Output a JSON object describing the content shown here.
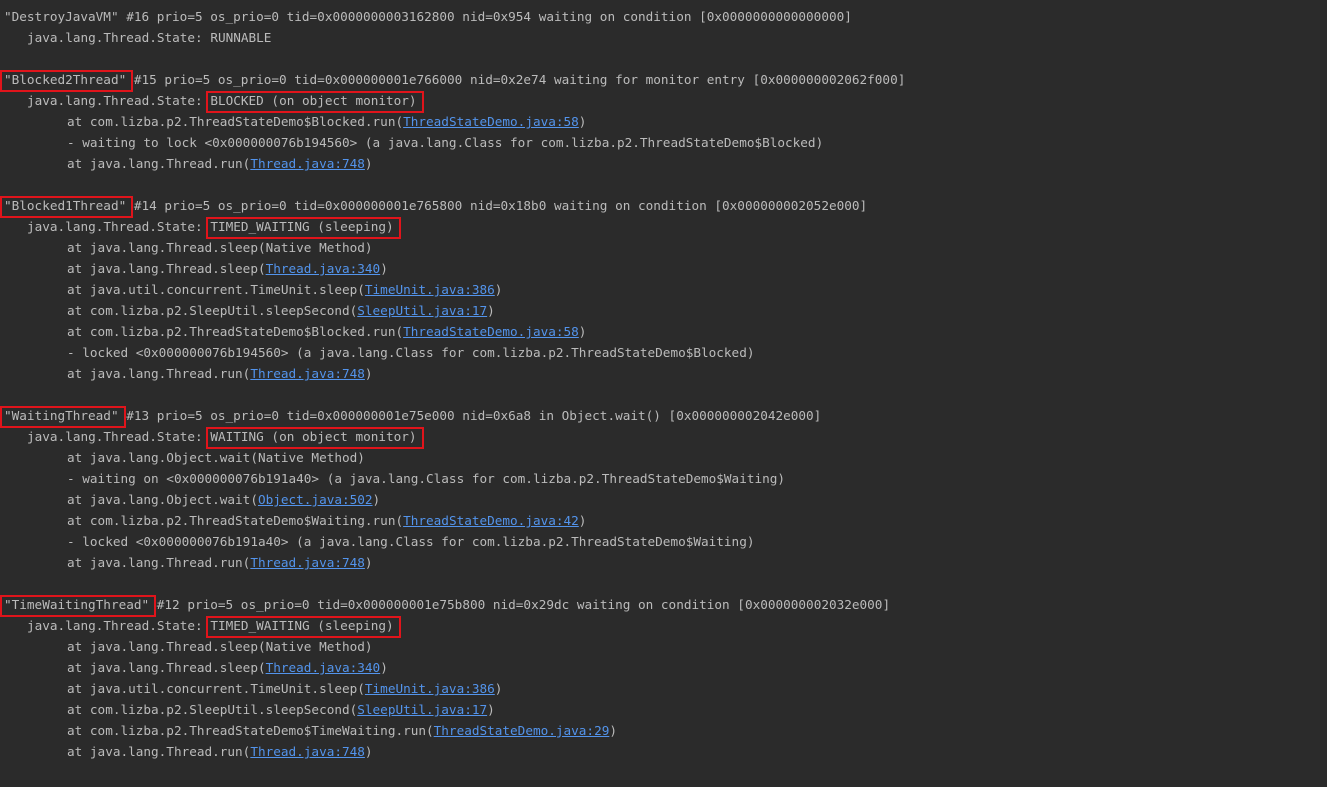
{
  "threads": [
    {
      "name": "\"DestroyJavaVM\"",
      "highlighted": false,
      "header_rest": " #16 prio=5 os_prio=0 tid=0x0000000003162800 nid=0x954 waiting on condition [0x0000000000000000]",
      "state_prefix": "java.lang.Thread.State: ",
      "state": "RUNNABLE",
      "state_highlighted": false,
      "frames": []
    },
    {
      "name": "\"Blocked2Thread\"",
      "highlighted": true,
      "header_rest": " #15 prio=5 os_prio=0 tid=0x000000001e766000 nid=0x2e74 waiting for monitor entry [0x000000002062f000]",
      "state_prefix": "java.lang.Thread.State: ",
      "state": "BLOCKED (on object monitor)",
      "state_highlighted": true,
      "frames": [
        {
          "pre": "at com.lizba.p2.ThreadStateDemo$Blocked.run(",
          "link": "ThreadStateDemo.java:58",
          "post": ")"
        },
        {
          "pre": "- waiting to lock <0x000000076b194560> (a java.lang.Class for com.lizba.p2.ThreadStateDemo$Blocked)",
          "link": "",
          "post": ""
        },
        {
          "pre": "at java.lang.Thread.run(",
          "link": "Thread.java:748",
          "post": ")"
        }
      ]
    },
    {
      "name": "\"Blocked1Thread\"",
      "highlighted": true,
      "header_rest": " #14 prio=5 os_prio=0 tid=0x000000001e765800 nid=0x18b0 waiting on condition [0x000000002052e000]",
      "state_prefix": "java.lang.Thread.State: ",
      "state": "TIMED_WAITING (sleeping)",
      "state_highlighted": true,
      "frames": [
        {
          "pre": "at java.lang.Thread.sleep(Native Method)",
          "link": "",
          "post": ""
        },
        {
          "pre": "at java.lang.Thread.sleep(",
          "link": "Thread.java:340",
          "post": ")"
        },
        {
          "pre": "at java.util.concurrent.TimeUnit.sleep(",
          "link": "TimeUnit.java:386",
          "post": ")"
        },
        {
          "pre": "at com.lizba.p2.SleepUtil.sleepSecond(",
          "link": "SleepUtil.java:17",
          "post": ")"
        },
        {
          "pre": "at com.lizba.p2.ThreadStateDemo$Blocked.run(",
          "link": "ThreadStateDemo.java:58",
          "post": ")"
        },
        {
          "pre": "- locked <0x000000076b194560> (a java.lang.Class for com.lizba.p2.ThreadStateDemo$Blocked)",
          "link": "",
          "post": ""
        },
        {
          "pre": "at java.lang.Thread.run(",
          "link": "Thread.java:748",
          "post": ")"
        }
      ]
    },
    {
      "name": "\"WaitingThread\"",
      "highlighted": true,
      "header_rest": " #13 prio=5 os_prio=0 tid=0x000000001e75e000 nid=0x6a8 in Object.wait() [0x000000002042e000]",
      "state_prefix": "java.lang.Thread.State: ",
      "state": "WAITING (on object monitor)",
      "state_highlighted": true,
      "frames": [
        {
          "pre": "at java.lang.Object.wait(Native Method)",
          "link": "",
          "post": ""
        },
        {
          "pre": "- waiting on <0x000000076b191a40> (a java.lang.Class for com.lizba.p2.ThreadStateDemo$Waiting)",
          "link": "",
          "post": ""
        },
        {
          "pre": "at java.lang.Object.wait(",
          "link": "Object.java:502",
          "post": ")"
        },
        {
          "pre": "at com.lizba.p2.ThreadStateDemo$Waiting.run(",
          "link": "ThreadStateDemo.java:42",
          "post": ")"
        },
        {
          "pre": "- locked <0x000000076b191a40> (a java.lang.Class for com.lizba.p2.ThreadStateDemo$Waiting)",
          "link": "",
          "post": ""
        },
        {
          "pre": "at java.lang.Thread.run(",
          "link": "Thread.java:748",
          "post": ")"
        }
      ]
    },
    {
      "name": "\"TimeWaitingThread\"",
      "highlighted": true,
      "header_rest": " #12 prio=5 os_prio=0 tid=0x000000001e75b800 nid=0x29dc waiting on condition [0x000000002032e000]",
      "state_prefix": "java.lang.Thread.State: ",
      "state": "TIMED_WAITING (sleeping)",
      "state_highlighted": true,
      "frames": [
        {
          "pre": "at java.lang.Thread.sleep(Native Method)",
          "link": "",
          "post": ""
        },
        {
          "pre": "at java.lang.Thread.sleep(",
          "link": "Thread.java:340",
          "post": ")"
        },
        {
          "pre": "at java.util.concurrent.TimeUnit.sleep(",
          "link": "TimeUnit.java:386",
          "post": ")"
        },
        {
          "pre": "at com.lizba.p2.SleepUtil.sleepSecond(",
          "link": "SleepUtil.java:17",
          "post": ")"
        },
        {
          "pre": "at com.lizba.p2.ThreadStateDemo$TimeWaiting.run(",
          "link": "ThreadStateDemo.java:29",
          "post": ")"
        },
        {
          "pre": "at java.lang.Thread.run(",
          "link": "Thread.java:748",
          "post": ")"
        }
      ]
    }
  ],
  "colors": {
    "background": "#2b2b2b",
    "text": "#bbbbbb",
    "link": "#5394ec",
    "highlight_box": "#e0141b"
  }
}
